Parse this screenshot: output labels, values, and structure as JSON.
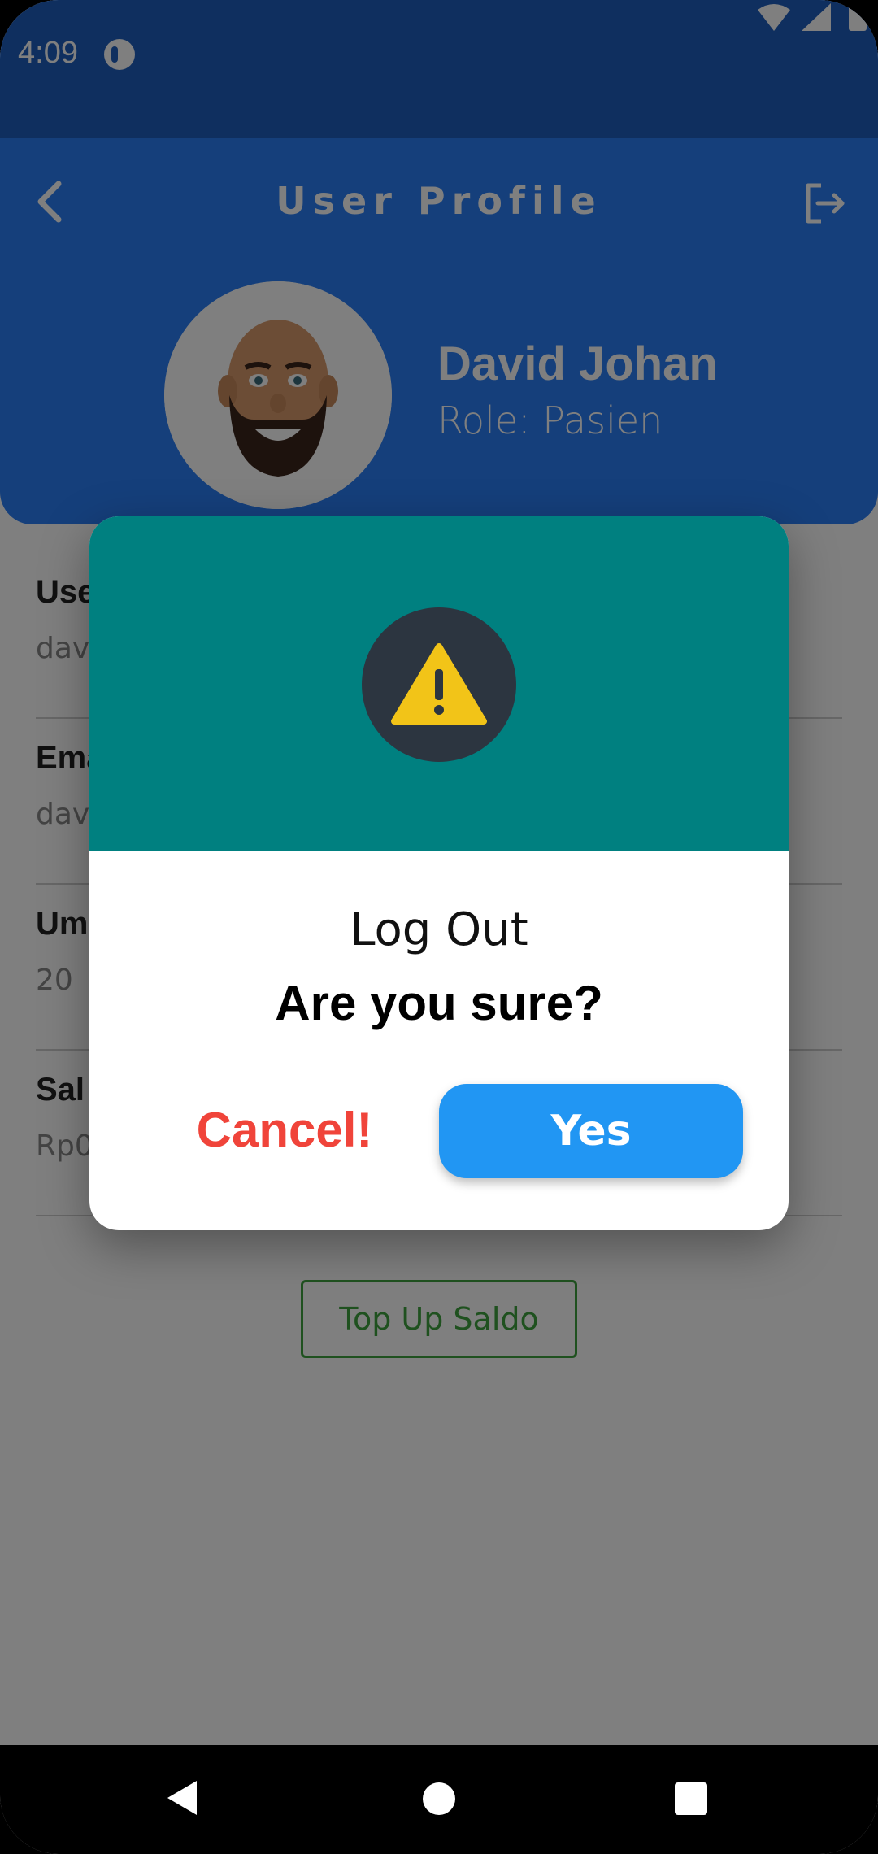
{
  "status_bar": {
    "time": "4:09"
  },
  "header": {
    "title": "User Profile",
    "user_name": "David Johan",
    "role": "Role: Pasien"
  },
  "fields": [
    {
      "label": "Use",
      "value": "dav"
    },
    {
      "label": "Ema",
      "value": "dav"
    },
    {
      "label": "Um",
      "value": "20"
    },
    {
      "label": "Sal",
      "value": "Rp0"
    }
  ],
  "topup_button": {
    "label": "Top Up Saldo"
  },
  "dialog": {
    "title": "Log Out",
    "message": "Are you sure?",
    "cancel_label": "Cancel!",
    "confirm_label": "Yes"
  },
  "colors": {
    "header": "#2b7ff6",
    "dialog_header": "#008080",
    "warning": "#f2c418",
    "cancel": "#f0443a",
    "confirm": "#2196f3",
    "topup": "#3fa33f"
  },
  "icons": {
    "back": "chevron-left-icon",
    "logout": "logout-icon",
    "warning": "warning-triangle-icon",
    "wifi": "wifi-icon",
    "signal": "signal-icon",
    "battery": "battery-icon"
  }
}
